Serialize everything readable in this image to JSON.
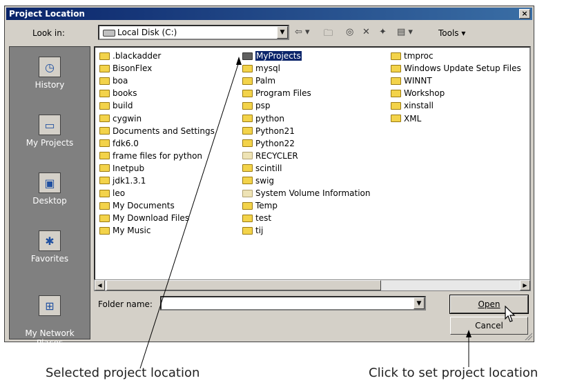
{
  "dialog": {
    "title": "Project Location",
    "close_glyph": "×"
  },
  "toolbar": {
    "look_in_label": "Look in:",
    "look_in_value": "Local Disk (C:)",
    "tools_label": "Tools ▾"
  },
  "places": [
    {
      "label": "History",
      "icon": "history-icon"
    },
    {
      "label": "My Projects",
      "icon": "folder-icon"
    },
    {
      "label": "Desktop",
      "icon": "desktop-icon"
    },
    {
      "label": "Favorites",
      "icon": "favorites-icon"
    },
    {
      "label": "My Network\nPlaces",
      "icon": "network-icon"
    }
  ],
  "files": {
    "col1": [
      ".blackadder",
      "BisonFlex",
      "boa",
      "books",
      "build",
      "cygwin",
      "Documents and Settings",
      "fdk6.0",
      "frame files for python",
      "Inetpub",
      "jdk1.3.1",
      "leo",
      "My Documents",
      "My Download Files",
      "My Music"
    ],
    "col2": [
      "MyProjects",
      "mysql",
      "Palm",
      "Program Files",
      "psp",
      "python",
      "Python21",
      "Python22",
      "RECYCLER",
      "scintill",
      "swig",
      "System Volume Information",
      "Temp",
      "test",
      "tij"
    ],
    "col3": [
      "tmproc",
      "Windows Update Setup Files",
      "WINNT",
      "Workshop",
      "xinstall",
      "XML"
    ],
    "selected": "MyProjects"
  },
  "form": {
    "folder_name_label": "Folder name:",
    "folder_name_value": "",
    "open_label": "Open",
    "cancel_label": "Cancel"
  },
  "captions": {
    "left": "Selected project location",
    "right": "Click to set project location"
  }
}
